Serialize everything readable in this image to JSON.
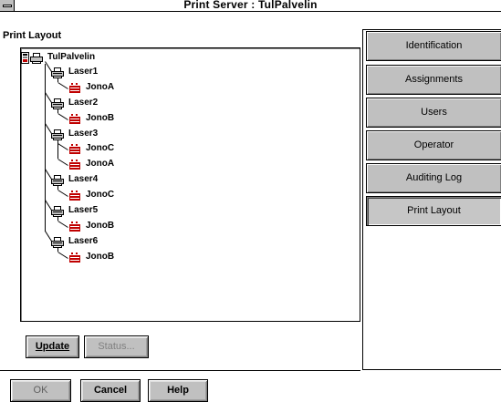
{
  "window": {
    "title": "Print Server : TulPalvelin"
  },
  "panel": {
    "heading": "Print Layout"
  },
  "tree": {
    "root": "TulPalvelin",
    "printers": [
      {
        "name": "Laser1",
        "queues": [
          "JonoA"
        ]
      },
      {
        "name": "Laser2",
        "queues": [
          "JonoB"
        ]
      },
      {
        "name": "Laser3",
        "queues": [
          "JonoC",
          "JonoA"
        ]
      },
      {
        "name": "Laser4",
        "queues": [
          "JonoC"
        ]
      },
      {
        "name": "Laser5",
        "queues": [
          "JonoB"
        ]
      },
      {
        "name": "Laser6",
        "queues": [
          "JonoB"
        ]
      }
    ]
  },
  "buttons": {
    "update": "Update",
    "status": "Status...",
    "ok": "OK",
    "cancel": "Cancel",
    "help": "Help"
  },
  "tabs": [
    {
      "label": "Identification",
      "active": false
    },
    {
      "label": "Assignments",
      "active": false
    },
    {
      "label": "Users",
      "active": false
    },
    {
      "label": "Operator",
      "active": false
    },
    {
      "label": "Auditing Log",
      "active": false
    },
    {
      "label": "Print Layout",
      "active": true
    }
  ],
  "colors": {
    "face": "#c0c0c0",
    "queue_icon": "#c00000"
  }
}
